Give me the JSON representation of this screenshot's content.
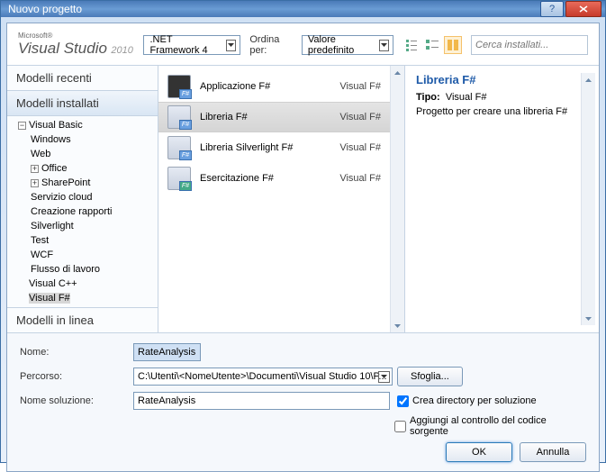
{
  "titlebar": {
    "title": "Nuovo progetto",
    "help": "?",
    "close": "X"
  },
  "logo": {
    "ms": "Microsoft®",
    "vs": "Visual Studio",
    "year": "2010"
  },
  "toolbar": {
    "framework": ".NET Framework 4",
    "sort_label": "Ordina per:",
    "sort_value": "Valore predefinito",
    "search_placeholder": "Cerca installati..."
  },
  "left": {
    "recent": "Modelli recenti",
    "installed": "Modelli installati",
    "online": "Modelli in linea",
    "tree": {
      "vb": "Visual Basic",
      "vb_children": [
        "Windows",
        "Web",
        "Office",
        "SharePoint",
        "Servizio cloud",
        "Creazione rapporti",
        "Silverlight",
        "Test",
        "WCF",
        "Flusso di lavoro"
      ],
      "vcpp": "Visual C++",
      "vfs": "Visual F#"
    }
  },
  "templates": [
    {
      "name": "Applicazione F#",
      "lang": "Visual F#",
      "badge": "F#"
    },
    {
      "name": "Libreria F#",
      "lang": "Visual F#",
      "badge": "F#"
    },
    {
      "name": "Libreria Silverlight F#",
      "lang": "Visual F#",
      "badge": "F#"
    },
    {
      "name": "Esercitazione F#",
      "lang": "Visual F#",
      "badge": "F#"
    }
  ],
  "details": {
    "title": "Libreria F#",
    "type_label": "Tipo:",
    "type_value": "Visual F#",
    "desc": "Progetto per creare una libreria F#"
  },
  "bottom": {
    "name_label": "Nome:",
    "name_value": "RateAnalysis",
    "path_label": "Percorso:",
    "path_value": "C:\\Utenti\\<NomeUtente>\\Documenti\\Visual Studio 10\\P...",
    "browse": "Sfoglia...",
    "sln_label": "Nome soluzione:",
    "sln_value": "RateAnalysis",
    "create_dir": "Crea directory per soluzione",
    "add_src": "Aggiungi al controllo del codice sorgente",
    "ok": "OK",
    "cancel": "Annulla"
  }
}
